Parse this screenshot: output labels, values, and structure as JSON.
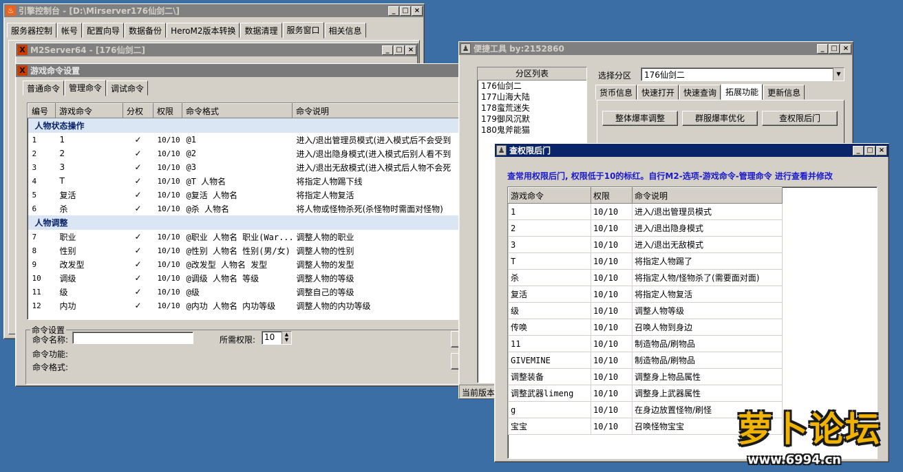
{
  "engine_console": {
    "title": "引擎控制台 - [D:\\Mirserver176仙剑二\\]",
    "tabs": [
      "服务器控制",
      "帐号",
      "配置向导",
      "数据备份",
      "HeroM2版本转换",
      "数据清理",
      "服务窗口",
      "相关信息"
    ],
    "selected_tab": "服务窗口"
  },
  "m2server": {
    "title": "M2Server64 - [176仙剑二]"
  },
  "cmd_settings": {
    "title": "游戏命令设置",
    "tabs": [
      "普通命令",
      "管理命令",
      "调试命令"
    ],
    "selected_tab": "管理命令",
    "columns": [
      "编号",
      "游戏命令",
      "分权",
      "权限",
      "命令格式",
      "命令说明"
    ],
    "groups": [
      {
        "title": "人物状态操作",
        "rows": [
          [
            "1",
            "1",
            "✓",
            "10/10",
            "@1",
            "进入/退出管理员模式(进入模式后不会受到"
          ],
          [
            "2",
            "2",
            "✓",
            "10/10",
            "@2",
            "进入/退出隐身模式(进入模式后别人看不到"
          ],
          [
            "3",
            "3",
            "✓",
            "10/10",
            "@3",
            "进入/退出无敌模式(进入模式后人物不会死"
          ],
          [
            "4",
            "T",
            "✓",
            "10/10",
            "@T 人物名",
            "将指定人物踢下线"
          ],
          [
            "5",
            "复活",
            "✓",
            "10/10",
            "@复活 人物名",
            "将指定人物复活"
          ],
          [
            "6",
            "杀",
            "✓",
            "10/10",
            "@杀 人物名",
            "将人物或怪物杀死(杀怪物时需面对怪物)"
          ]
        ]
      },
      {
        "title": "人物调整",
        "rows": [
          [
            "7",
            "职业",
            "✓",
            "10/10",
            "@职业 人物名 职业(War...",
            "调整人物的职业"
          ],
          [
            "8",
            "性别",
            "✓",
            "10/10",
            "@性别 人物名 性别(男/女)",
            "调整人物的性别"
          ],
          [
            "9",
            "改发型",
            "✓",
            "10/10",
            "@改发型 人物名 发型",
            "调整人物的发型"
          ],
          [
            "10",
            "调级",
            "✓",
            "10/10",
            "@调级 人物名 等级",
            "调整人物的等级"
          ],
          [
            "11",
            "级",
            "✓",
            "10/10",
            "@级",
            "调整自己的等级"
          ],
          [
            "12",
            "内功",
            "✓",
            "10/10",
            "@内功 人物名 内功等级",
            "调整人物的内功等级"
          ]
        ]
      }
    ],
    "settings": {
      "legend": "命令设置",
      "name_label": "命令名称:",
      "name_value": "",
      "perm_label": "所需权限:",
      "perm_value": "10",
      "func_label": "命令功能:",
      "format_label": "命令格式:"
    }
  },
  "quick_tool": {
    "title": "便捷工具   by:2152860",
    "partition_list_header": "分区列表",
    "partitions": [
      "176仙剑二",
      "177山海大陆",
      "178蛮荒迷失",
      "179御风沉默",
      "180鬼斧能猫"
    ],
    "select_label": "选择分区",
    "select_value": "176仙剑二",
    "tabs": [
      "货币信息",
      "快速打开",
      "快速查询",
      "拓展功能",
      "更新信息"
    ],
    "selected_tab": "拓展功能",
    "buttons": [
      "整体爆率调整",
      "群服爆率优化",
      "查权限后门"
    ],
    "status": "当前版本"
  },
  "backdoor": {
    "title": "查权限后门",
    "notice": "查常用权限后门, 权限低于10的标红。自行M2-选项-游戏命令-管理命令 进行查看并修改",
    "columns": [
      "游戏命令",
      "权限",
      "命令说明"
    ],
    "rows": [
      [
        "1",
        "10/10",
        "进入/退出管理员模式"
      ],
      [
        "2",
        "10/10",
        "进入/退出隐身模式"
      ],
      [
        "3",
        "10/10",
        "进入/退出无敌模式"
      ],
      [
        "T",
        "10/10",
        "将指定人物踢了"
      ],
      [
        "杀",
        "10/10",
        "将指定人物/怪物杀了(需要面对面)"
      ],
      [
        "复活",
        "10/10",
        "将指定人物复活"
      ],
      [
        "级",
        "10/10",
        "调整人物等级"
      ],
      [
        "传唤",
        "10/10",
        "召唤人物到身边"
      ],
      [
        "11",
        "10/10",
        "制造物品/刷物品"
      ],
      [
        "GIVEMINE",
        "10/10",
        "制造物品/刷物品"
      ],
      [
        "调整装备",
        "10/10",
        "调整身上物品属性"
      ],
      [
        "调整武器limeng",
        "10/10",
        "调整身上武器属性"
      ],
      [
        "g",
        "10/10",
        "在身边放置怪物/刷怪"
      ],
      [
        "宝宝",
        "10/10",
        "召唤怪物宝宝"
      ]
    ]
  },
  "watermark": {
    "logo_text": "萝卜论坛",
    "url": "www.6994.cn"
  },
  "colors": {
    "desktop": "#3a6ea5",
    "title_active": "#0a246a",
    "title_inactive": "#808080",
    "group_header_bg": "#dbe6f5",
    "group_header_text": "#0a246a",
    "notice_text": "#1a1acc"
  }
}
